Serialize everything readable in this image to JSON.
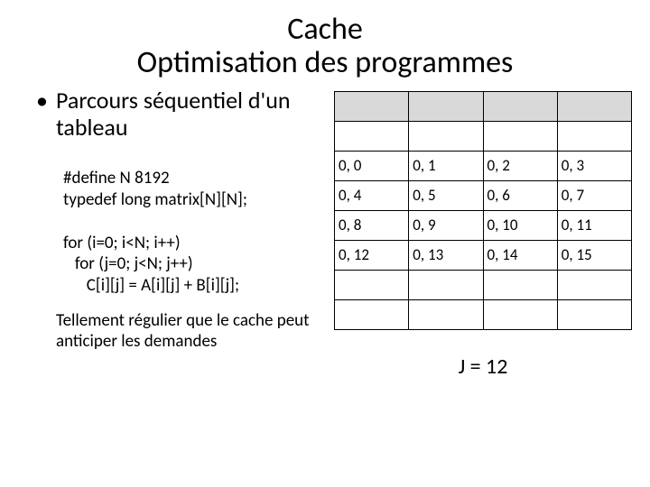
{
  "title_line1": "Cache",
  "title_line2": "Optimisation des programmes",
  "bullet": "Parcours séquentiel d'un tableau",
  "code_lines": [
    "#define N 8192",
    "typedef long matrix[N][N];",
    "",
    "for (i=0; i<N; i++)",
    "   for (j=0; j<N; j++)",
    "      C[i][j] = A[i][j] + B[i][j];"
  ],
  "note": "Tellement régulier que le cache peut anticiper les demandes",
  "table": {
    "rows": [
      {
        "shaded": true,
        "cells": [
          "",
          "",
          "",
          ""
        ]
      },
      {
        "shaded": false,
        "cells": [
          "",
          "",
          "",
          ""
        ]
      },
      {
        "shaded": false,
        "cells": [
          "0, 0",
          "0, 1",
          "0, 2",
          "0, 3"
        ]
      },
      {
        "shaded": false,
        "cells": [
          "0, 4",
          "0, 5",
          "0, 6",
          "0, 7"
        ]
      },
      {
        "shaded": false,
        "cells": [
          "0, 8",
          "0, 9",
          "0, 10",
          "0, 11"
        ]
      },
      {
        "shaded": false,
        "cells": [
          "0, 12",
          "0, 13",
          "0, 14",
          "0, 15"
        ]
      },
      {
        "shaded": false,
        "cells": [
          "",
          "",
          "",
          ""
        ]
      },
      {
        "shaded": false,
        "cells": [
          "",
          "",
          "",
          ""
        ]
      }
    ]
  },
  "caption": "J = 12"
}
